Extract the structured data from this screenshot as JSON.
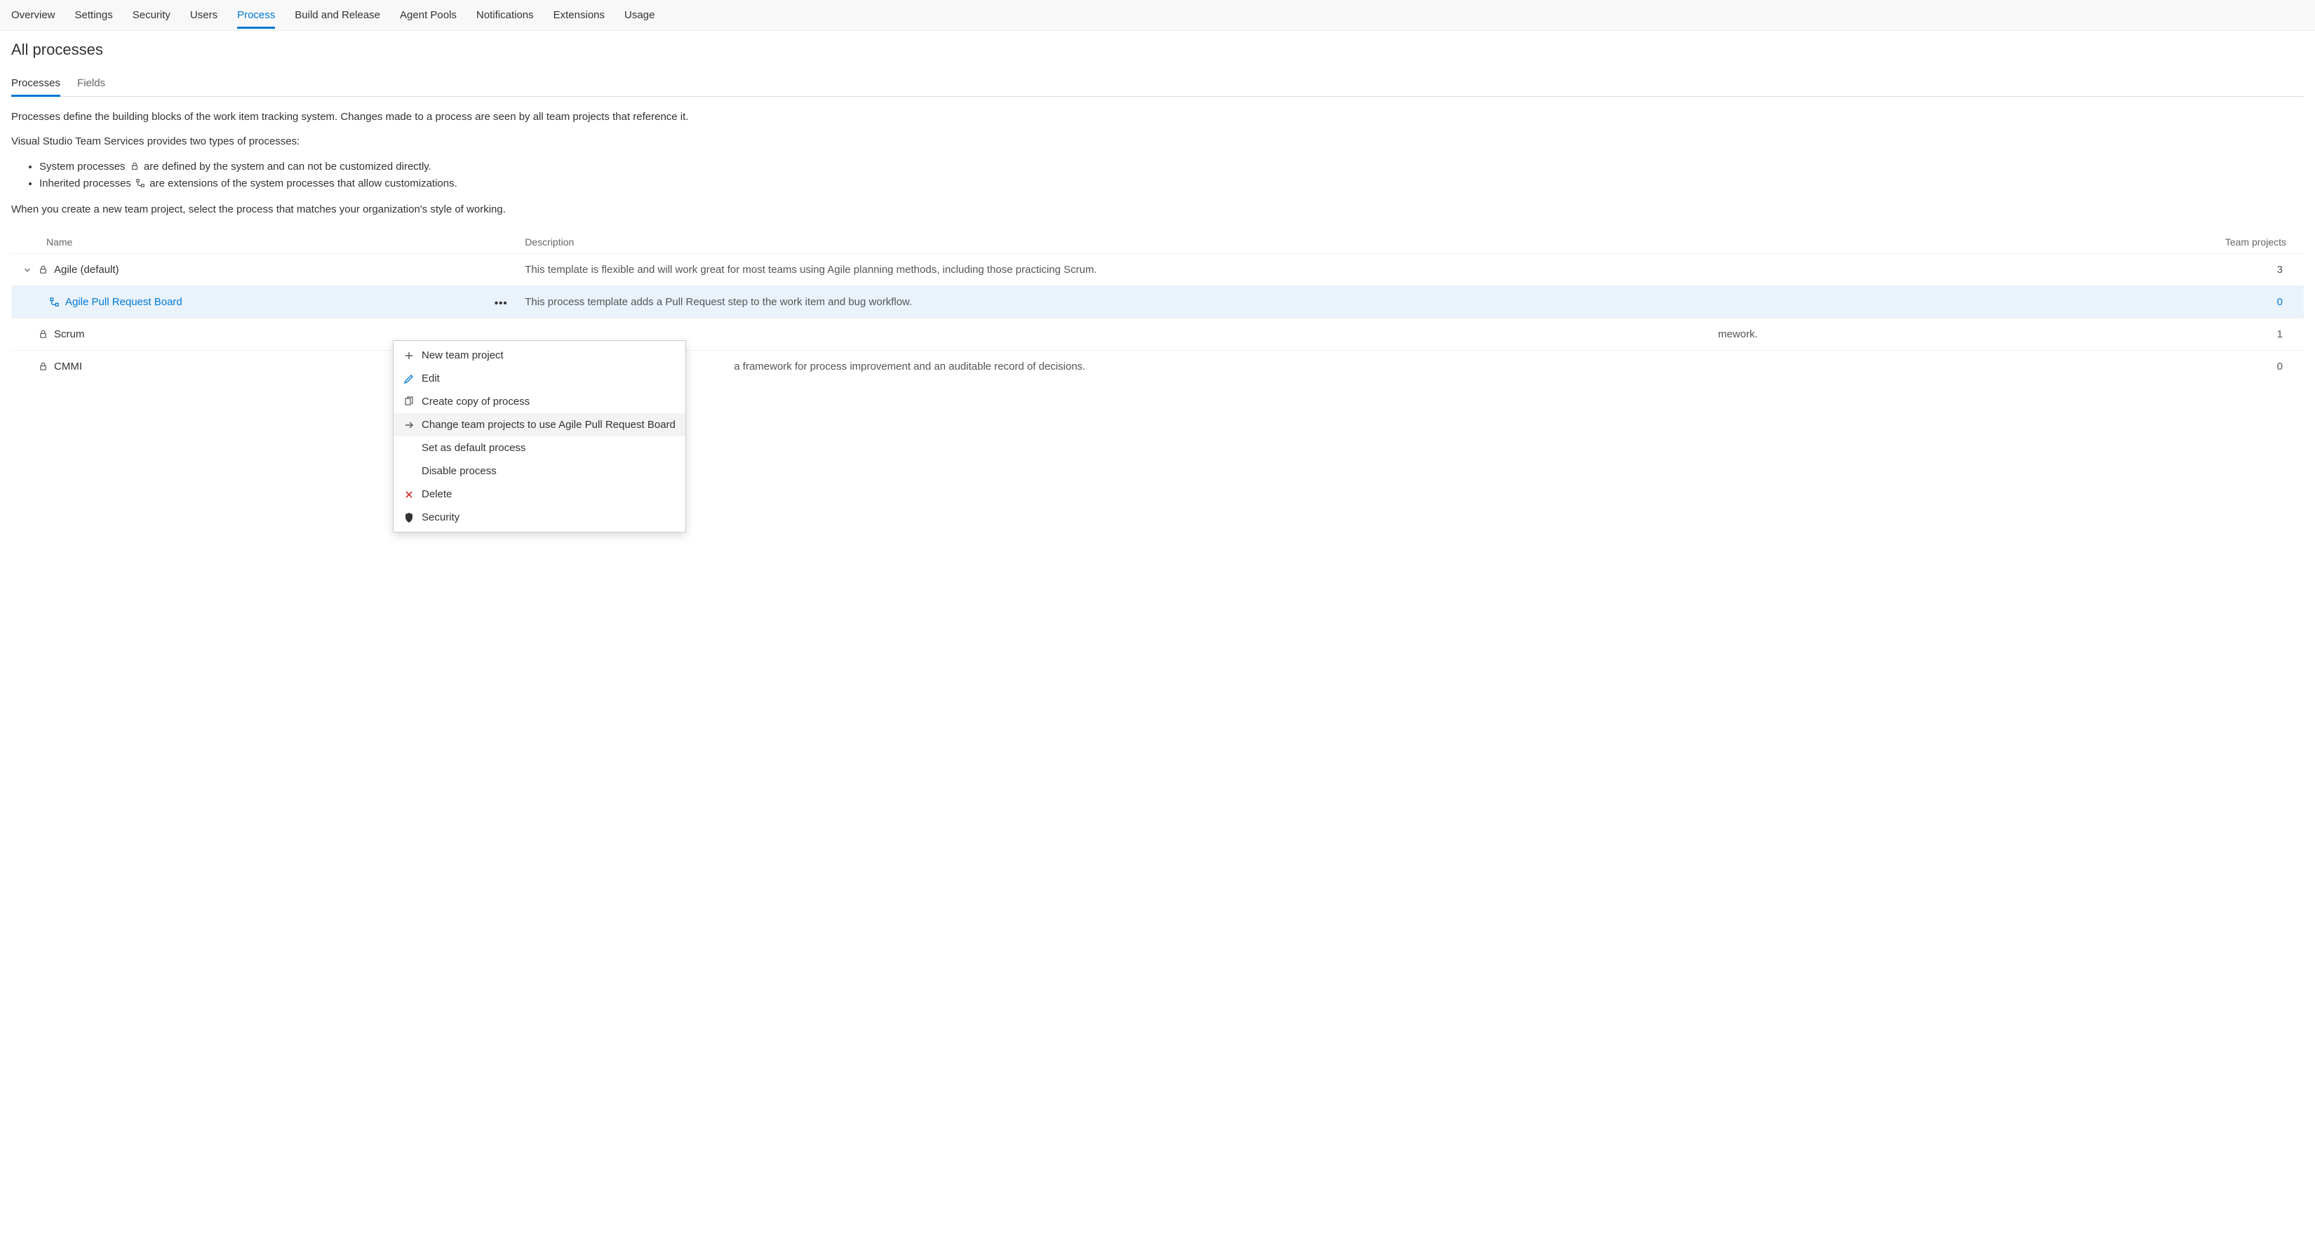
{
  "topnav": {
    "items": [
      "Overview",
      "Settings",
      "Security",
      "Users",
      "Process",
      "Build and Release",
      "Agent Pools",
      "Notifications",
      "Extensions",
      "Usage"
    ],
    "active_index": 4
  },
  "page_title": "All processes",
  "subtabs": {
    "items": [
      "Processes",
      "Fields"
    ],
    "active_index": 0
  },
  "intro": {
    "p1": "Processes define the building blocks of the work item tracking system. Changes made to a process are seen by all team projects that reference it.",
    "p2": "Visual Studio Team Services provides two types of processes:",
    "bullet1_pre": "System processes ",
    "bullet1_post": " are defined by the system and can not be customized directly.",
    "bullet2_pre": "Inherited processes ",
    "bullet2_post": " are extensions of the system processes that allow customizations.",
    "p3": "When you create a new team project, select the process that matches your organization's style of working."
  },
  "table": {
    "headers": {
      "name": "Name",
      "description": "Description",
      "team_projects": "Team projects"
    },
    "rows": [
      {
        "name": "Agile (default)",
        "desc": "This template is flexible and will work great for most teams using Agile planning methods, including those practicing Scrum.",
        "count": "3",
        "type": "system",
        "parent": true
      },
      {
        "name": "Agile Pull Request Board",
        "desc": "This process template adds a Pull Request step to the work item and bug workflow.",
        "count": "0",
        "type": "inherited",
        "selected": true
      },
      {
        "name": "Scrum",
        "desc": "mework.",
        "count": "1",
        "type": "system"
      },
      {
        "name": "CMMI",
        "desc": "a framework for process improvement and an auditable record of decisions.",
        "count": "0",
        "type": "system"
      }
    ]
  },
  "menu": {
    "items": [
      {
        "icon": "plus",
        "label": "New team project"
      },
      {
        "icon": "edit",
        "label": "Edit"
      },
      {
        "icon": "copy",
        "label": "Create copy of process"
      },
      {
        "icon": "arrow",
        "label": "Change team projects to use Agile Pull Request Board",
        "hover": true
      },
      {
        "icon": "",
        "label": "Set as default process"
      },
      {
        "icon": "",
        "label": "Disable process"
      },
      {
        "icon": "delete",
        "label": "Delete"
      },
      {
        "icon": "shield",
        "label": "Security"
      }
    ]
  }
}
